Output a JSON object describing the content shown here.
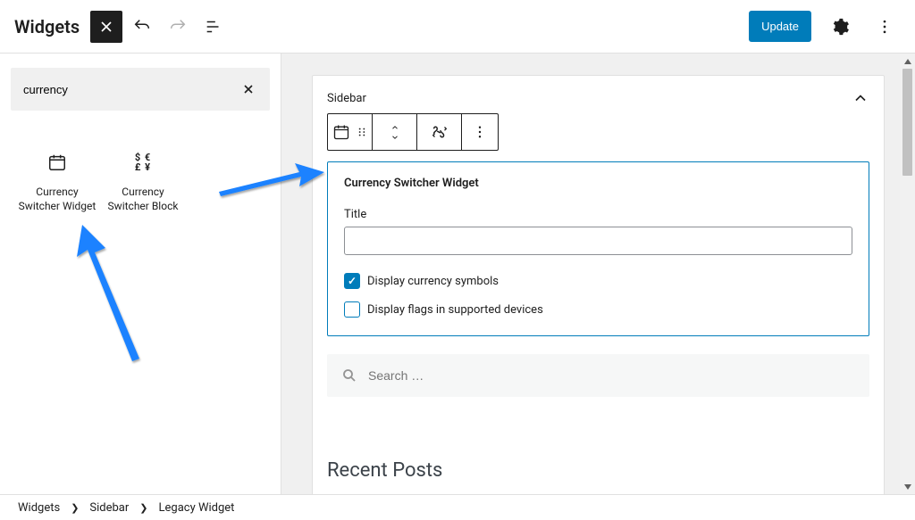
{
  "header": {
    "title": "Widgets",
    "update_label": "Update"
  },
  "search": {
    "value": "currency",
    "placeholder": "Search"
  },
  "blocks": [
    {
      "label": "Currency Switcher Widget"
    },
    {
      "label": "Currency Switcher Block"
    }
  ],
  "sidebar_area": {
    "title": "Sidebar"
  },
  "selected_widget": {
    "heading": "Currency Switcher Widget",
    "title_label": "Title",
    "title_value": "",
    "opt_symbols": "Display currency symbols",
    "opt_symbols_checked": true,
    "opt_flags": "Display flags in supported devices",
    "opt_flags_checked": false
  },
  "search_widget": {
    "placeholder": "Search …"
  },
  "recent_posts": {
    "heading": "Recent Posts"
  },
  "breadcrumbs": [
    "Widgets",
    "Sidebar",
    "Legacy Widget"
  ]
}
